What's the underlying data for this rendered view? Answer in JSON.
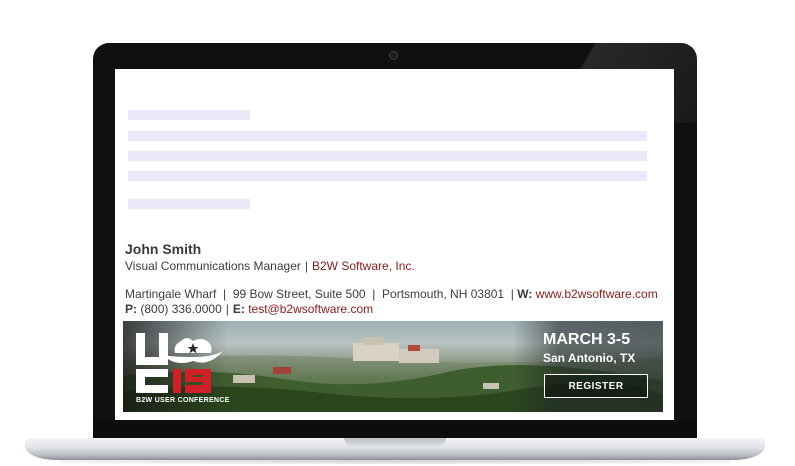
{
  "signature": {
    "name": "John Smith",
    "title": "Visual Communications Manager",
    "company": "B2W Software, Inc.",
    "address": "Martingale Wharf  |  99 Bow Street, Suite 500  |  Portsmouth, NH 03801  |",
    "web_label": "W:",
    "website": "www.b2wsoftware.com",
    "phone_label": "P:",
    "phone": "(800) 336.0000",
    "email_label": "E:",
    "email": "test@b2wsoftware.com"
  },
  "banner": {
    "logo_text": "UC19",
    "conference": "B2W USER CONFERENCE",
    "date": "MARCH 3-5",
    "location": "San Antonio, TX",
    "register": "REGISTER",
    "icon": "cowboy-hat-icon"
  },
  "colors": {
    "link": "#8b1a1a",
    "accent_red": "#d11f2a",
    "skeleton": "#ebe9f8"
  }
}
